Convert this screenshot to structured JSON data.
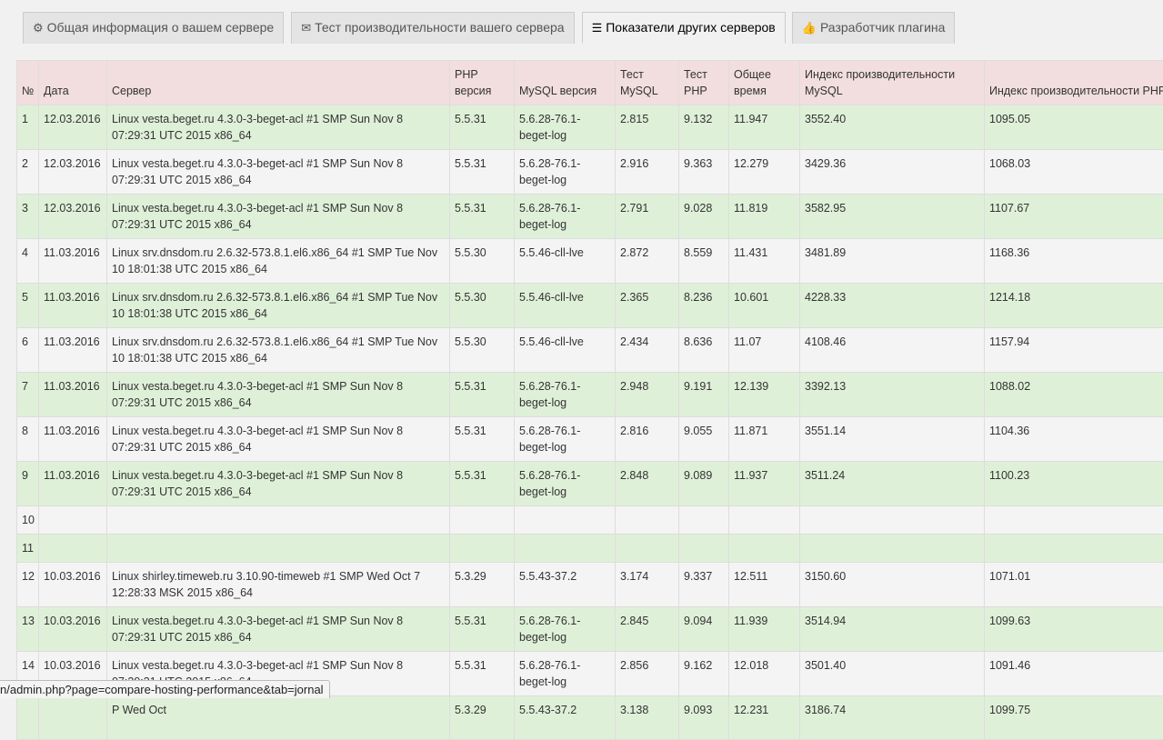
{
  "tabs": [
    {
      "label": "Общая информация о вашем сервере",
      "icon": "gear-icon",
      "glyph": "⚙",
      "active": false
    },
    {
      "label": "Тест производительности вашего сервера",
      "icon": "envelope-icon",
      "glyph": "✉",
      "active": false
    },
    {
      "label": "Показатели других серверов",
      "icon": "list-icon",
      "glyph": "☰",
      "active": true
    },
    {
      "label": "Разработчик плагина",
      "icon": "thumbs-up-icon",
      "glyph": "👍",
      "active": false
    }
  ],
  "table": {
    "headers": [
      "№",
      "Дата",
      "Сервер",
      "PHP версия",
      "MySQL версия",
      "Тест MySQL",
      "Тест PHP",
      "Общее время",
      "Индекс производительности MySQL",
      "Индекс производительности PHP"
    ],
    "rows": [
      [
        "1",
        "12.03.2016",
        "Linux vesta.beget.ru 4.3.0-3-beget-acl #1 SMP Sun Nov 8 07:29:31 UTC 2015 x86_64",
        "5.5.31",
        "5.6.28-76.1-beget-log",
        "2.815",
        "9.132",
        "11.947",
        "3552.40",
        "1095.05"
      ],
      [
        "2",
        "12.03.2016",
        "Linux vesta.beget.ru 4.3.0-3-beget-acl #1 SMP Sun Nov 8 07:29:31 UTC 2015 x86_64",
        "5.5.31",
        "5.6.28-76.1-beget-log",
        "2.916",
        "9.363",
        "12.279",
        "3429.36",
        "1068.03"
      ],
      [
        "3",
        "12.03.2016",
        "Linux vesta.beget.ru 4.3.0-3-beget-acl #1 SMP Sun Nov 8 07:29:31 UTC 2015 x86_64",
        "5.5.31",
        "5.6.28-76.1-beget-log",
        "2.791",
        "9.028",
        "11.819",
        "3582.95",
        "1107.67"
      ],
      [
        "4",
        "11.03.2016",
        "Linux srv.dnsdom.ru 2.6.32-573.8.1.el6.x86_64 #1 SMP Tue Nov 10 18:01:38 UTC 2015 x86_64",
        "5.5.30",
        "5.5.46-cll-lve",
        "2.872",
        "8.559",
        "11.431",
        "3481.89",
        "1168.36"
      ],
      [
        "5",
        "11.03.2016",
        "Linux srv.dnsdom.ru 2.6.32-573.8.1.el6.x86_64 #1 SMP Tue Nov 10 18:01:38 UTC 2015 x86_64",
        "5.5.30",
        "5.5.46-cll-lve",
        "2.365",
        "8.236",
        "10.601",
        "4228.33",
        "1214.18"
      ],
      [
        "6",
        "11.03.2016",
        "Linux srv.dnsdom.ru 2.6.32-573.8.1.el6.x86_64 #1 SMP Tue Nov 10 18:01:38 UTC 2015 x86_64",
        "5.5.30",
        "5.5.46-cll-lve",
        "2.434",
        "8.636",
        "11.07",
        "4108.46",
        "1157.94"
      ],
      [
        "7",
        "11.03.2016",
        "Linux vesta.beget.ru 4.3.0-3-beget-acl #1 SMP Sun Nov 8 07:29:31 UTC 2015 x86_64",
        "5.5.31",
        "5.6.28-76.1-beget-log",
        "2.948",
        "9.191",
        "12.139",
        "3392.13",
        "1088.02"
      ],
      [
        "8",
        "11.03.2016",
        "Linux vesta.beget.ru 4.3.0-3-beget-acl #1 SMP Sun Nov 8 07:29:31 UTC 2015 x86_64",
        "5.5.31",
        "5.6.28-76.1-beget-log",
        "2.816",
        "9.055",
        "11.871",
        "3551.14",
        "1104.36"
      ],
      [
        "9",
        "11.03.2016",
        "Linux vesta.beget.ru 4.3.0-3-beget-acl #1 SMP Sun Nov 8 07:29:31 UTC 2015 x86_64",
        "5.5.31",
        "5.6.28-76.1-beget-log",
        "2.848",
        "9.089",
        "11.937",
        "3511.24",
        "1100.23"
      ],
      [
        "10",
        "",
        "",
        "",
        "",
        "",
        "",
        "",
        "",
        ""
      ],
      [
        "11",
        "",
        "",
        "",
        "",
        "",
        "",
        "",
        "",
        ""
      ],
      [
        "12",
        "10.03.2016",
        "Linux shirley.timeweb.ru 3.10.90-timeweb #1 SMP Wed Oct 7 12:28:33 MSK 2015 x86_64",
        "5.3.29",
        "5.5.43-37.2",
        "3.174",
        "9.337",
        "12.511",
        "3150.60",
        "1071.01"
      ],
      [
        "13",
        "10.03.2016",
        "Linux vesta.beget.ru 4.3.0-3-beget-acl #1 SMP Sun Nov 8 07:29:31 UTC 2015 x86_64",
        "5.5.31",
        "5.6.28-76.1-beget-log",
        "2.845",
        "9.094",
        "11.939",
        "3514.94",
        "1099.63"
      ],
      [
        "14",
        "10.03.2016",
        "Linux vesta.beget.ru 4.3.0-3-beget-acl #1 SMP Sun Nov 8 07:29:31 UTC 2015 x86_64",
        "5.5.31",
        "5.6.28-76.1-beget-log",
        "2.856",
        "9.162",
        "12.018",
        "3501.40",
        "1091.46"
      ],
      [
        "",
        "",
        "P Wed Oct",
        "5.3.29",
        "5.5.43-37.2",
        "3.138",
        "9.093",
        "12.231",
        "3186.74",
        "1099.75"
      ]
    ]
  },
  "colors": {
    "header": "#f2dede",
    "row_green": "#dff0d8",
    "row_plain": "#f4f4f4"
  },
  "status_bar": {
    "url": "n/admin.php?page=compare-hosting-performance&tab=jornal"
  }
}
